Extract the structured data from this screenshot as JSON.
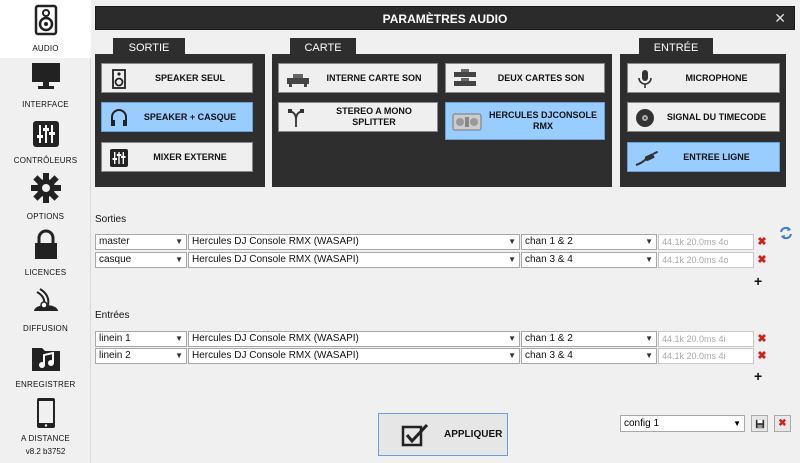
{
  "sidebar": {
    "items": [
      {
        "label": "AUDIO",
        "icon": "speaker-icon"
      },
      {
        "label": "INTERFACE",
        "icon": "monitor-icon"
      },
      {
        "label": "CONTRÔLEURS",
        "icon": "sliders-icon"
      },
      {
        "label": "OPTIONS",
        "icon": "gear-icon"
      },
      {
        "label": "LICENCES",
        "icon": "lock-icon"
      },
      {
        "label": "DIFFUSION",
        "icon": "broadcast-icon"
      },
      {
        "label": "ENREGISTRER",
        "icon": "music-folder-icon"
      },
      {
        "label": "A DISTANCE",
        "icon": "tablet-icon"
      }
    ],
    "version": "v8.2 b3752"
  },
  "titlebar": {
    "title": "PARAMÈTRES AUDIO",
    "close": "✕"
  },
  "sortie": {
    "tab": "SORTIE",
    "options": [
      {
        "label": "SPEAKER SEUL",
        "selected": false
      },
      {
        "label": "SPEAKER + CASQUE",
        "selected": true
      },
      {
        "label": "MIXER EXTERNE",
        "selected": false
      }
    ]
  },
  "carte": {
    "tab": "CARTE",
    "options": [
      {
        "label": "INTERNE CARTE SON",
        "selected": false
      },
      {
        "label": "DEUX CARTES SON",
        "selected": false
      },
      {
        "label": "STEREO A MONO SPLITTER",
        "selected": false
      },
      {
        "label": "HERCULES DJCONSOLE RMX",
        "selected": true
      }
    ]
  },
  "entree": {
    "tab": "ENTRÉE",
    "options": [
      {
        "label": "MICROPHONE",
        "selected": false
      },
      {
        "label": "SIGNAL DU TIMECODE",
        "selected": false
      },
      {
        "label": "ENTREE LIGNE",
        "selected": true
      }
    ]
  },
  "sorties": {
    "label": "Sorties",
    "rows": [
      {
        "name": "master",
        "device": "Hercules DJ Console RMX (WASAPI)",
        "channel": "chan 1 & 2",
        "info": "44.1k 20.0ms 4o"
      },
      {
        "name": "casque",
        "device": "Hercules DJ Console RMX (WASAPI)",
        "channel": "chan 3 & 4",
        "info": "44.1k 20.0ms 4o"
      }
    ]
  },
  "entrees": {
    "label": "Entrées",
    "rows": [
      {
        "name": "linein 1",
        "device": "Hercules DJ Console RMX (WASAPI)",
        "channel": "chan 1 & 2",
        "info": "44.1k 20.0ms 4i"
      },
      {
        "name": "linein 2",
        "device": "Hercules DJ Console RMX (WASAPI)",
        "channel": "chan 3 & 4",
        "info": "44.1k 20.0ms 4i"
      }
    ]
  },
  "apply": {
    "label": "APPLIQUER"
  },
  "config": {
    "value": "config 1"
  },
  "colors": {
    "selected": "#99ccff",
    "panel": "#2e2e2e",
    "delete": "#cc2222"
  }
}
